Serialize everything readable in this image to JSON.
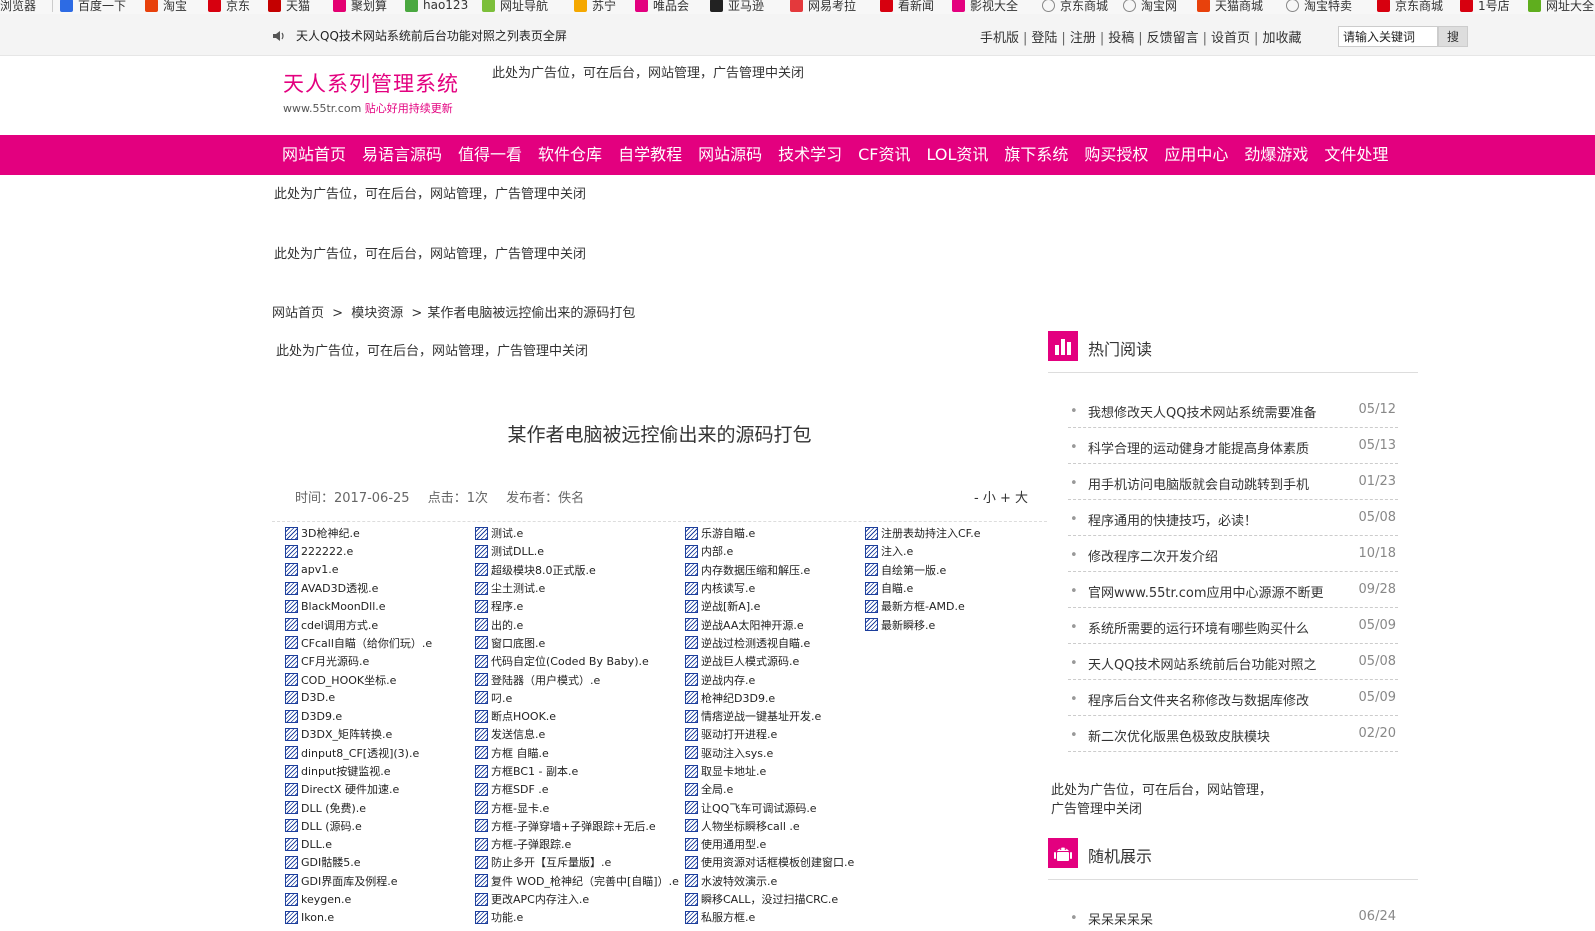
{
  "bookmarks": [
    {
      "label": "浏览器",
      "icon": "",
      "color": ""
    },
    {
      "label": "百度一下",
      "icon": "paw-icon",
      "color": "#2d6be4"
    },
    {
      "label": "淘宝",
      "icon": "taobao-icon",
      "color": "#e8410b"
    },
    {
      "label": "京东",
      "icon": "jd-icon",
      "color": "#d7000f"
    },
    {
      "label": "天猫",
      "icon": "tmall-icon",
      "color": "#c40000"
    },
    {
      "label": "聚划算",
      "icon": "juhuasuan-icon",
      "color": "#e40072"
    },
    {
      "label": "hao123",
      "icon": "hao123-icon",
      "color": "#4aa840"
    },
    {
      "label": "网址导航",
      "icon": "nav-7654-icon",
      "color": "#7cbf3a"
    },
    {
      "label": "苏宁",
      "icon": "suning-icon",
      "color": "#f5a800"
    },
    {
      "label": "唯品会",
      "icon": "vip-icon",
      "color": "#e3007f"
    },
    {
      "label": "亚马逊",
      "icon": "amazon-icon",
      "color": "#222222"
    },
    {
      "label": "网易考拉",
      "icon": "kaola-icon",
      "color": "#e4393c"
    },
    {
      "label": "看新闻",
      "icon": "news-icon",
      "color": "#d7000f"
    },
    {
      "label": "影视大全",
      "icon": "play-icon",
      "color": "#e4007f"
    },
    {
      "label": "京东商城",
      "icon": "globe-icon",
      "color": "#888888"
    },
    {
      "label": "淘宝网",
      "icon": "globe-icon",
      "color": "#888888"
    },
    {
      "label": "天猫商城",
      "icon": "tmall-icon",
      "color": "#e8410b"
    },
    {
      "label": "淘宝特卖",
      "icon": "globe-icon",
      "color": "#888888"
    },
    {
      "label": "京东商城",
      "icon": "jd-icon",
      "color": "#d7000f"
    },
    {
      "label": "1号店",
      "icon": "yhd-icon",
      "color": "#d7000f"
    },
    {
      "label": "网址大全",
      "icon": "plus-icon",
      "color": "#5fae1e"
    }
  ],
  "topbar": {
    "notice": "天人QQ技术网站系统前后台功能对照之列表页全屏",
    "links": [
      "手机版",
      "登陆",
      "注册",
      "投稿",
      "反馈留言",
      "设首页",
      "加收藏"
    ],
    "search_value": "请输入关键词",
    "search_button": "搜"
  },
  "logo": {
    "title": "天人系列管理系统",
    "url": "www.55tr.com",
    "slogan": "贴心好用持续更新"
  },
  "ads": {
    "header": "此处为广告位，可在后台，网站管理，广告管理中关闭",
    "a1": "此处为广告位，可在后台，网站管理，广告管理中关闭",
    "a2": "此处为广告位，可在后台，网站管理，广告管理中关闭",
    "a3": "此处为广告位，可在后台，网站管理，广告管理中关闭",
    "side_line1": "此处为广告位，可在后台，网站管理，",
    "side_line2": "广告管理中关闭"
  },
  "nav": [
    "网站首页",
    "易语言源码",
    "值得一看",
    "软件仓库",
    "自学教程",
    "网站源码",
    "技术学习",
    "CF资讯",
    "LOL资讯",
    "旗下系统",
    "购买授权",
    "应用中心",
    "劲爆游戏",
    "文件处理"
  ],
  "breadcrumb": {
    "home": "网站首页",
    "sep1": ">",
    "cat": "模块资源",
    "sep2": ">",
    "current": "某作者电脑被远控偷出来的源码打包"
  },
  "article": {
    "title": "某作者电脑被远控偷出来的源码打包",
    "time": "时间：2017-06-25",
    "clicks": "点击：1次",
    "author": "发布者：佚名",
    "font_small": "- 小",
    "font_big": "+ 大"
  },
  "files": [
    [
      "3D枪神纪.e",
      "222222.e",
      "apv1.e",
      "AVAD3D透视.e",
      "BlackMoonDll.e",
      "cdel调用方式.e",
      "CFcall自瞄（给你们玩）.e",
      "CF月光源码.e",
      "COD_HOOK坐标.e",
      "D3D.e",
      "D3D9.e",
      "D3DX_矩阵转换.e",
      "dinput8_CF[透视](3).e",
      "dinput按键监视.e",
      "DirectX 硬件加速.e",
      "DLL (免费).e",
      "DLL (源码.e",
      "DLL.e",
      "GDI骷髅5.e",
      "GDI界面库及例程.e",
      "keygen.e",
      "Ikon.e"
    ],
    [
      "测试.e",
      "测试DLL.e",
      "超级模块8.0正式版.e",
      "尘土测试.e",
      "程序.e",
      "出的.e",
      "窗口底图.e",
      "代码自定位(Coded By Baby).e",
      "登陆器（用户模式）.e",
      "叼.e",
      "断点HOOK.e",
      "发送信息.e",
      "方框 自瞄.e",
      "方框BC1 - 副本.e",
      "方框SDF .e",
      "方框-显卡.e",
      "方框-子弹穿墙+子弹跟踪+无后.e",
      "方框-子弹跟踪.e",
      "防止多开【互斥量版】.e",
      "复件 WOD_枪神纪（完善中[自瞄]）.e",
      "更改APC内存注入.e",
      "功能.e"
    ],
    [
      "乐游自瞄.e",
      "内部.e",
      "内存数据压缩和解压.e",
      "内核读写.e",
      "逆战[新A].e",
      "逆战AA太阳神开源.e",
      "逆战过检测透视自瞄.e",
      "逆战巨人模式源码.e",
      "逆战内存.e",
      "枪神纪D3D9.e",
      "情痞逆战一键基址开发.e",
      "驱动打开进程.e",
      "驱动注入sys.e",
      "取显卡地址.e",
      "全局.e",
      "让QQ飞车可调试源码.e",
      "人物坐标瞬移call .e",
      "使用通用型.e",
      "使用资源对话框模板创建窗口.e",
      "水波特效演示.e",
      "瞬移CALL，没过扫描CRC.e",
      "私服方框.e"
    ],
    [
      "注册表劫持注入CF.e",
      "注入.e",
      "自绘第一版.e",
      "自瞄.e",
      "最新方框-AMD.e",
      "最新瞬移.e"
    ]
  ],
  "sidebar": {
    "hot_title": "热门阅读",
    "hot": [
      {
        "title": "我想修改天人QQ技术网站系统需要准备",
        "date": "05/12"
      },
      {
        "title": "科学合理的运动健身才能提高身体素质",
        "date": "05/13"
      },
      {
        "title": "用手机访问电脑版就会自动跳转到手机",
        "date": "01/23"
      },
      {
        "title": "程序通用的快捷技巧，必读！",
        "date": "05/08"
      },
      {
        "title": "修改程序二次开发介绍",
        "date": "10/18"
      },
      {
        "title": "官网www.55tr.com应用中心源源不断更",
        "date": "09/28"
      },
      {
        "title": "系统所需要的运行环境有哪些购买什么",
        "date": "05/09"
      },
      {
        "title": "天人QQ技术网站系统前后台功能对照之",
        "date": "05/08"
      },
      {
        "title": "程序后台文件夹名称修改与数据库修改",
        "date": "05/09"
      },
      {
        "title": "新二次优化版黑色极致皮肤模块",
        "date": "02/20"
      }
    ],
    "random_title": "随机展示",
    "random": [
      {
        "title": "呆呆呆呆呆",
        "date": "06/24"
      }
    ]
  },
  "colors": {
    "brand": "#e3007f",
    "nav_text": "#ffffff"
  }
}
